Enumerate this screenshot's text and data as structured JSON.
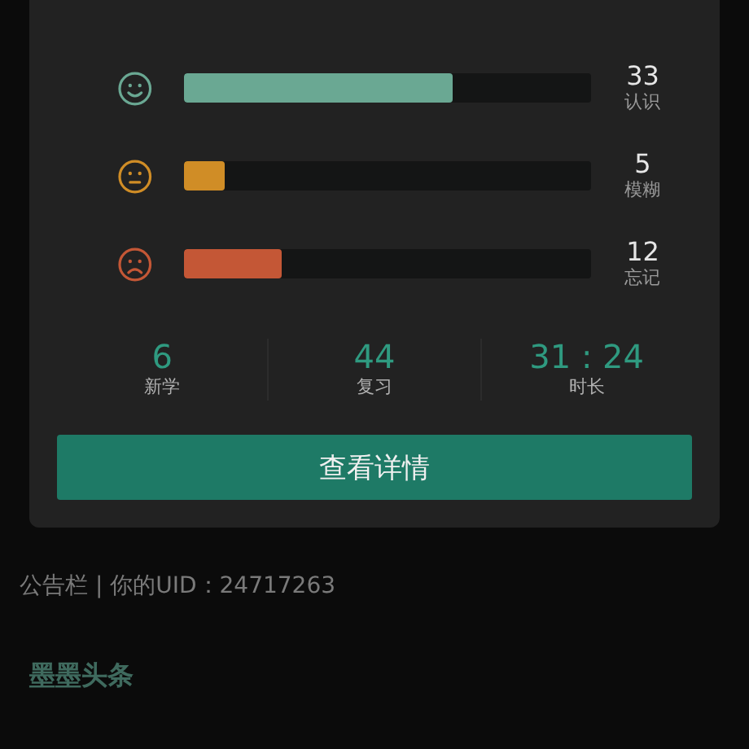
{
  "progress_rows": [
    {
      "kind": "happy",
      "color": "#6aa893",
      "level": 0.66,
      "count": "33",
      "label": "认识"
    },
    {
      "kind": "neutral",
      "color": "#d08d26",
      "level": 0.1,
      "count": "5",
      "label": "模糊"
    },
    {
      "kind": "sad",
      "color": "#c45736",
      "level": 0.24,
      "count": "12",
      "label": "忘记"
    }
  ],
  "stats": [
    {
      "value": "6",
      "label": "新学"
    },
    {
      "value": "44",
      "label": "复习"
    },
    {
      "value": "31 : 24",
      "label": "时长"
    }
  ],
  "details_button": "查看详情",
  "notice": "公告栏 | 你的UID：24717263",
  "section_title": "墨墨头条"
}
